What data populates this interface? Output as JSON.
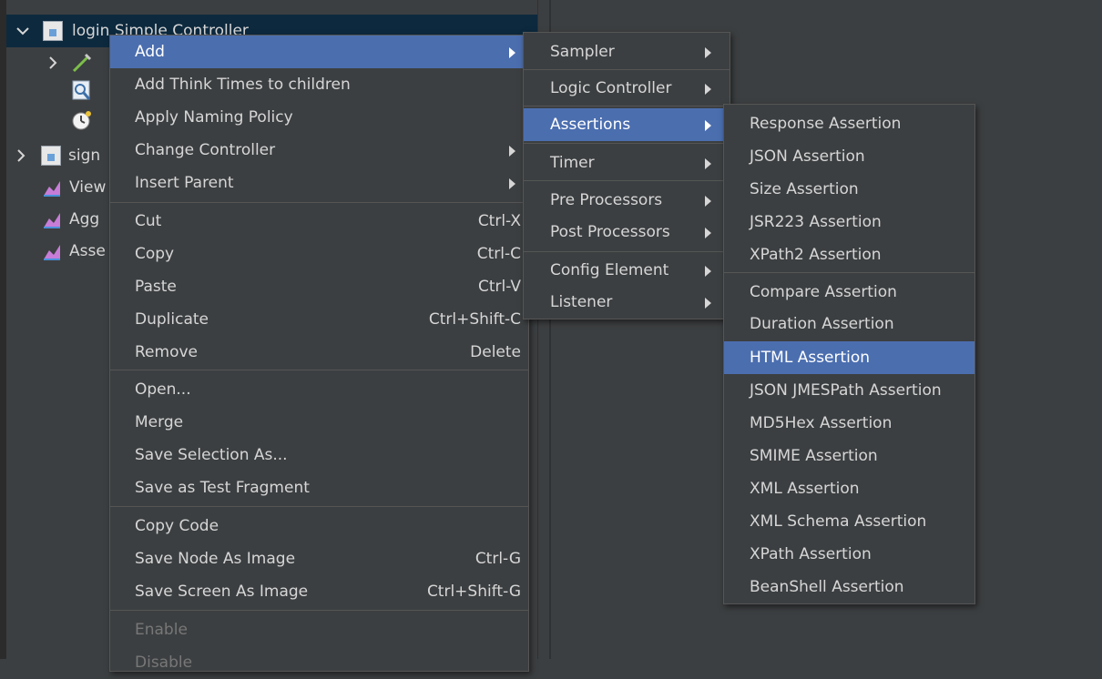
{
  "tree": {
    "rows": [
      {
        "label": "login Simple Controller"
      },
      {
        "label": ""
      },
      {
        "label": ""
      },
      {
        "label": ""
      },
      {
        "label": "sign"
      },
      {
        "label": "View"
      },
      {
        "label": "Agg"
      },
      {
        "label": "Asse"
      }
    ]
  },
  "context_menu": {
    "items": [
      {
        "label": "Add",
        "shortcut": ""
      },
      {
        "label": "Add Think Times to children",
        "shortcut": ""
      },
      {
        "label": "Apply Naming Policy",
        "shortcut": ""
      },
      {
        "label": "Change Controller",
        "shortcut": ""
      },
      {
        "label": "Insert Parent",
        "shortcut": ""
      },
      {
        "label": "Cut",
        "shortcut": "Ctrl-X"
      },
      {
        "label": "Copy",
        "shortcut": "Ctrl-C"
      },
      {
        "label": "Paste",
        "shortcut": "Ctrl-V"
      },
      {
        "label": "Duplicate",
        "shortcut": "Ctrl+Shift-C"
      },
      {
        "label": "Remove",
        "shortcut": "Delete"
      },
      {
        "label": "Open...",
        "shortcut": ""
      },
      {
        "label": "Merge",
        "shortcut": ""
      },
      {
        "label": "Save Selection As...",
        "shortcut": ""
      },
      {
        "label": "Save as Test Fragment",
        "shortcut": ""
      },
      {
        "label": "Copy Code",
        "shortcut": ""
      },
      {
        "label": "Save Node As Image",
        "shortcut": "Ctrl-G"
      },
      {
        "label": "Save Screen As Image",
        "shortcut": "Ctrl+Shift-G"
      },
      {
        "label": "Enable",
        "shortcut": ""
      },
      {
        "label": "Disable",
        "shortcut": ""
      }
    ]
  },
  "add_submenu": {
    "items": [
      {
        "label": "Sampler"
      },
      {
        "label": "Logic Controller"
      },
      {
        "label": "Assertions"
      },
      {
        "label": "Timer"
      },
      {
        "label": "Pre Processors"
      },
      {
        "label": "Post Processors"
      },
      {
        "label": "Config Element"
      },
      {
        "label": "Listener"
      }
    ]
  },
  "assertions_submenu": {
    "items": [
      {
        "label": "Response Assertion"
      },
      {
        "label": "JSON Assertion"
      },
      {
        "label": "Size Assertion"
      },
      {
        "label": "JSR223 Assertion"
      },
      {
        "label": "XPath2 Assertion"
      },
      {
        "label": "Compare Assertion"
      },
      {
        "label": "Duration Assertion"
      },
      {
        "label": "HTML Assertion"
      },
      {
        "label": "JSON JMESPath Assertion"
      },
      {
        "label": "MD5Hex Assertion"
      },
      {
        "label": "SMIME Assertion"
      },
      {
        "label": "XML Assertion"
      },
      {
        "label": "XML Schema Assertion"
      },
      {
        "label": "XPath Assertion"
      },
      {
        "label": "BeanShell Assertion"
      }
    ]
  },
  "colors": {
    "background": "#3c3f41",
    "menu_highlight": "#4b6eaf",
    "tree_selection": "#0d293e",
    "text": "#d6d6d6",
    "disabled_text": "#777777"
  }
}
